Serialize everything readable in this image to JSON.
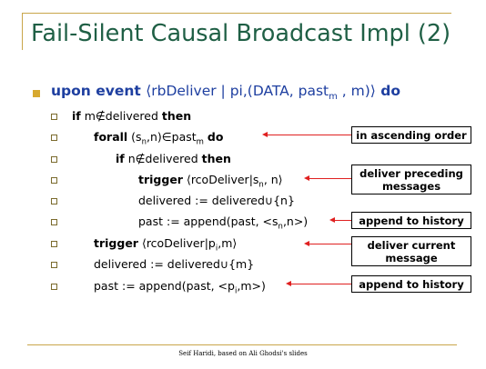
{
  "title": "Fail-Silent Causal Broadcast Impl (2)",
  "main": {
    "kw_upon": "upon event",
    "open": "⟨rbDeliver | pi,(DATA, past",
    "sub_m": "m",
    "close": " , m)⟩",
    "kw_do": "do"
  },
  "lines": [
    {
      "kw": "if",
      "text": " m∉delivered ",
      "kw2": "then"
    },
    {
      "kw": "forall",
      "pre": " (s",
      "s1": "n",
      "mid": ",n)∈past",
      "s2": "m",
      "post": " ",
      "kw2": "do"
    },
    {
      "kw": "if",
      "text": " n∉delivered ",
      "kw2": "then"
    },
    {
      "kw": "trigger",
      "pre": " ⟨rcoDeliver|s",
      "s1": "n",
      "post": ", n⟩"
    },
    {
      "text": "delivered := delivered∪{n}"
    },
    {
      "pre": "past := append(past, <s",
      "s1": "n",
      "post": ",n>)"
    },
    {
      "kw": "trigger",
      "pre": " ⟨rcoDeliver|p",
      "s1": "i",
      "post": ",m⟩"
    },
    {
      "text": "delivered := delivered∪{m}"
    },
    {
      "pre": "past := append(past, <p",
      "s1": "i",
      "post": ",m>)"
    }
  ],
  "notes": {
    "ascending": "in ascending order",
    "preceding_1": "deliver preceding",
    "preceding_2": "messages",
    "history_1": "append to history",
    "current_1": "deliver current",
    "current_2": "message",
    "history_2": "append to history"
  },
  "footer": "Seif Haridi, based on Ali Ghodsi's slides",
  "colors": {
    "title": "#1f5f45",
    "keyword": "#1e3fa0",
    "accent": "#d7a930",
    "arrow": "#e02020",
    "rule": "#c9a64a"
  }
}
